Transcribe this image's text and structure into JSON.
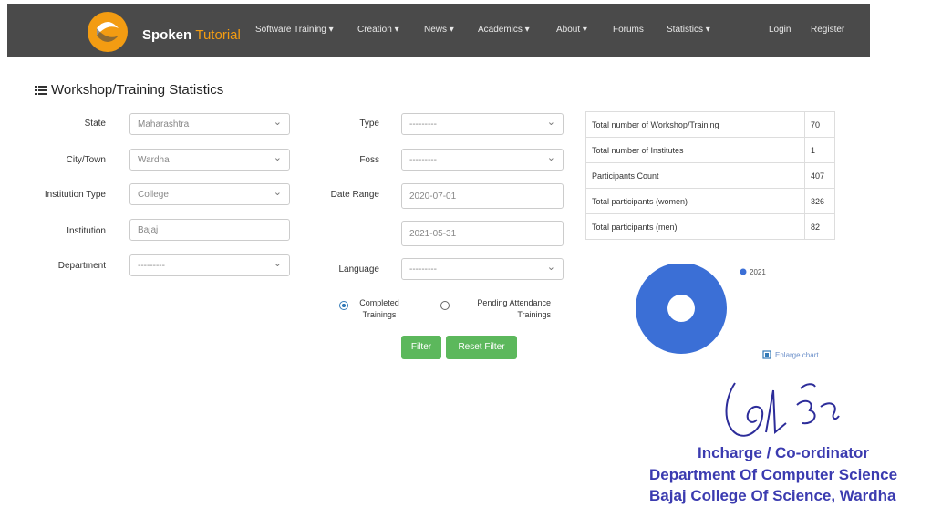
{
  "navbar": {
    "brand_1": "Spoken",
    "brand_2": "Tutorial",
    "items": [
      "Software Training ▾",
      "Creation ▾",
      "News ▾",
      "Academics ▾",
      "About ▾",
      "Forums",
      "Statistics ▾",
      "Login",
      "Register"
    ]
  },
  "page": {
    "title": "Workshop/Training Statistics"
  },
  "filters": {
    "state": {
      "label": "State",
      "value": "Maharashtra"
    },
    "city": {
      "label": "City/Town",
      "value": "Wardha"
    },
    "institution_type": {
      "label": "Institution Type",
      "value": "College"
    },
    "institution": {
      "label": "Institution",
      "value": "Bajaj"
    },
    "department": {
      "label": "Department",
      "value": "---------"
    },
    "type": {
      "label": "Type",
      "value": "---------"
    },
    "foss": {
      "label": "Foss",
      "value": "---------"
    },
    "date_range": {
      "label": "Date Range",
      "from": "2020-07-01",
      "to": "2021-05-31"
    },
    "language": {
      "label": "Language",
      "value": "---------"
    },
    "status_completed": "Completed Trainings",
    "status_pending": "Pending Attendance Trainings",
    "filter_button": "Filter",
    "reset_button": "Reset Filter"
  },
  "stats": [
    {
      "label": "Total number of Workshop/Training",
      "value": "70"
    },
    {
      "label": "Total number of Institutes",
      "value": "1"
    },
    {
      "label": "Participants Count",
      "value": "407"
    },
    {
      "label": "Total participants (women)",
      "value": "326"
    },
    {
      "label": "Total participants (men)",
      "value": "82"
    }
  ],
  "chart_data": {
    "type": "pie",
    "categories": [
      "2021"
    ],
    "values": [
      70
    ],
    "legend": "top-right",
    "color": "#3b6fd6"
  },
  "chart_footer": "Enlarge chart",
  "stamp": {
    "line1": "Incharge / Co-ordinator",
    "line2": "Department Of Computer Science",
    "line3": "Bajaj College Of Science, Wardha"
  }
}
